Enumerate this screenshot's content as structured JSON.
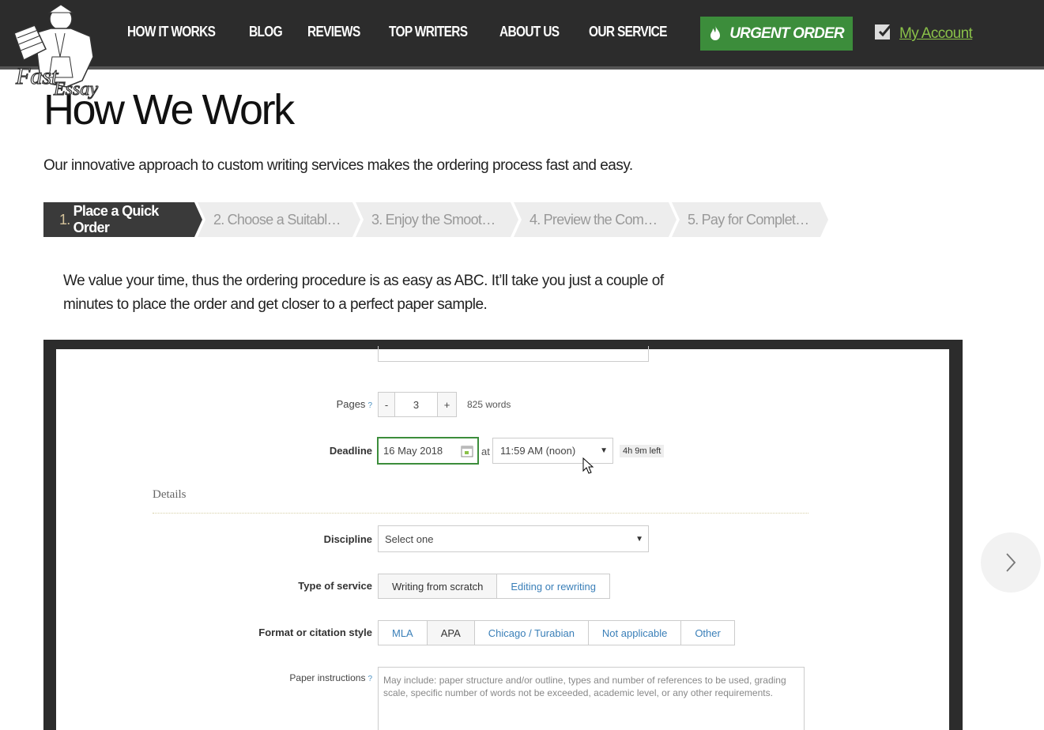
{
  "header": {
    "logo_text": "Fast Essay",
    "nav": [
      "HOW IT WORKS",
      "BLOG",
      "REVIEWS",
      "TOP WRITERS",
      "ABOUT US",
      "OUR SERVICE"
    ],
    "urgent_label": "URGENT ORDER",
    "account_label": "My Account"
  },
  "page": {
    "title": "How We Work",
    "lead": "Our innovative approach to custom writing services makes the ordering process fast and easy.",
    "steps": [
      {
        "num": "1.",
        "label": "Place a Quick Order"
      },
      {
        "num": "2.",
        "label": "Choose a Suitabl…"
      },
      {
        "num": "3.",
        "label": "Enjoy the Smoot…"
      },
      {
        "num": "4.",
        "label": "Preview the Com…"
      },
      {
        "num": "5.",
        "label": "Pay for Complet…"
      }
    ],
    "description": "We value your time, thus the ordering procedure is as easy as ABC. It’ll take you just a couple of minutes to place the order and get closer to a perfect paper sample."
  },
  "form": {
    "pages_label": "Pages",
    "pages_minus": "-",
    "pages_value": "3",
    "pages_plus": "+",
    "words": "825 words",
    "deadline_label": "Deadline",
    "deadline_date": "16 May 2018",
    "at": "at",
    "deadline_time": "11:59 AM (noon)",
    "time_left": "4h 9m left",
    "details_heading": "Details",
    "discipline_label": "Discipline",
    "discipline_value": "Select one",
    "service_label": "Type of service",
    "service_options": [
      "Writing from scratch",
      "Editing or rewriting"
    ],
    "format_label": "Format or citation style",
    "format_options": [
      "MLA",
      "APA",
      "Chicago / Turabian",
      "Not applicable",
      "Other"
    ],
    "instructions_label": "Paper instructions",
    "instructions_placeholder": "May include: paper structure and/or outline, types and number of references to be used, grading scale, specific number of words not be exceeded, academic level, or any other requirements."
  },
  "colors": {
    "topbar": "#2c2c2c",
    "urgent": "#3c8d3b",
    "account_link": "#8ac149",
    "step_active": "#3a3a3a"
  }
}
